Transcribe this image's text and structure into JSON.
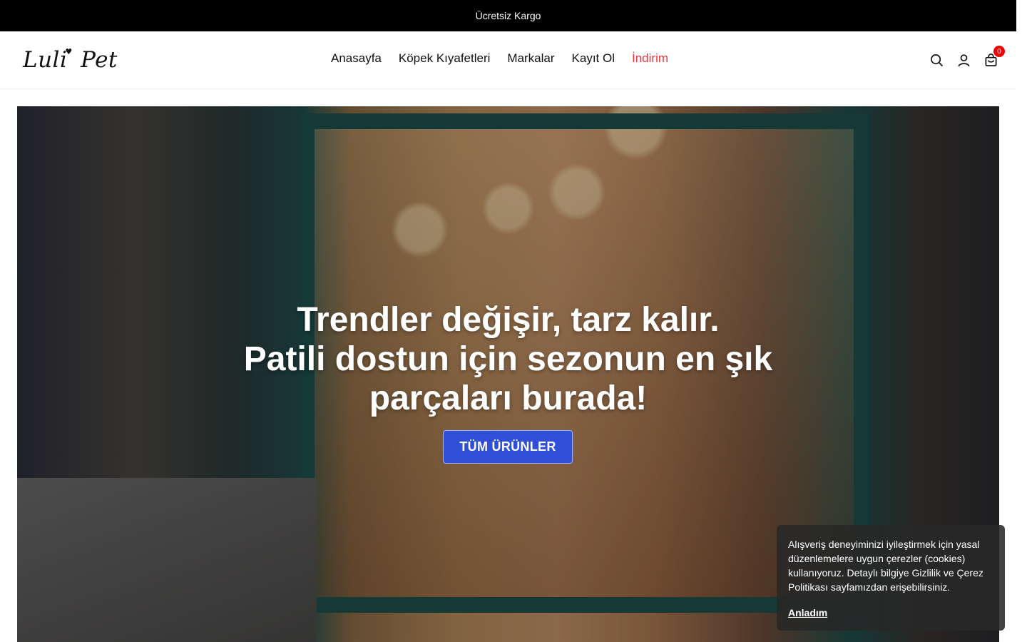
{
  "announcement": {
    "text": "Ücretsiz Kargo"
  },
  "header": {
    "logo_main": "Luli",
    "logo_second": "Pet",
    "nav": [
      {
        "label": "Anasayfa"
      },
      {
        "label": "Köpek Kıyafetleri"
      },
      {
        "label": "Markalar"
      },
      {
        "label": "Kayıt Ol"
      },
      {
        "label": "İndirim",
        "color": "#e8333a"
      }
    ],
    "icons": [
      "search-icon",
      "account-icon",
      "cart-icon"
    ],
    "cart_count": "0"
  },
  "hero": {
    "headline_line1": "Trendler değişir, tarz kalır.",
    "headline_line2": "Patili dostun için sezonun en şık",
    "headline_line3": "parçaları burada!",
    "cta_label": "TÜM ÜRÜNLER",
    "cta_color": "#2f4fd6"
  },
  "cookie_banner": {
    "text": "Alışveriş deneyiminizi iyileştirmek için yasal düzenlemelere uygun çerezler (cookies) kullanıyoruz. Detaylı bilgiye Gizlilik ve Çerez Politikası sayfamızdan erişebilirsiniz.",
    "accept_label": "Anladım"
  }
}
